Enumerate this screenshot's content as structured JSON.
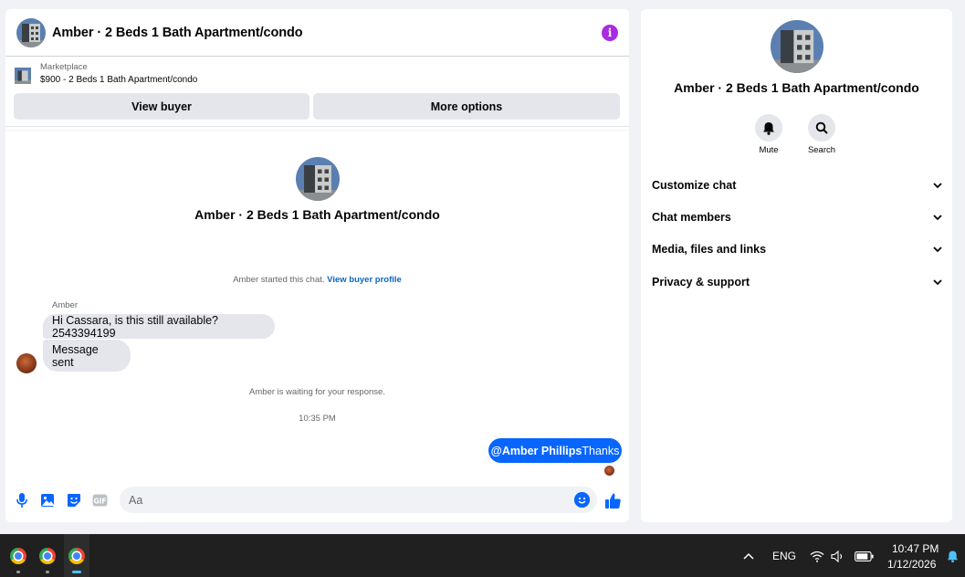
{
  "chat": {
    "title": "Amber · 2 Beds 1 Bath Apartment/condo",
    "marketplace_label": "Marketplace",
    "listing": "$900 - 2 Beds 1 Bath Apartment/condo",
    "view_buyer_label": "View buyer",
    "more_options_label": "More options",
    "intro_title": "Amber · 2 Beds 1 Bath Apartment/condo",
    "started_text": "Amber started this chat.",
    "view_profile_link": "View buyer profile",
    "sender_name": "Amber",
    "messages": [
      {
        "text": "Hi Cassara, is this still available? 2543394199"
      },
      {
        "text": "Message sent"
      }
    ],
    "waiting_text": "Amber is waiting for your response.",
    "timestamp": "10:35 PM",
    "outgoing": {
      "mention": "@Amber Phillips",
      "text": "Thanks"
    },
    "composer_placeholder": "Aa",
    "icons": [
      "mic-icon",
      "photo-icon",
      "sticker-icon",
      "gif-icon",
      "emoji-icon",
      "like-icon",
      "info-icon"
    ]
  },
  "info": {
    "title": "Amber · 2 Beds 1 Bath Apartment/condo",
    "mute_label": "Mute",
    "search_label": "Search",
    "sections": [
      {
        "label": "Customize chat"
      },
      {
        "label": "Chat members"
      },
      {
        "label": "Media, files and links"
      },
      {
        "label": "Privacy & support"
      }
    ]
  },
  "taskbar": {
    "language": "ENG",
    "time": "10:47 PM",
    "date": "1/12/2026"
  },
  "colors": {
    "accent": "#0866ff",
    "info_purple": "#a82be0",
    "bubble_gray": "#e4e6eb",
    "taskbar": "#202020"
  }
}
